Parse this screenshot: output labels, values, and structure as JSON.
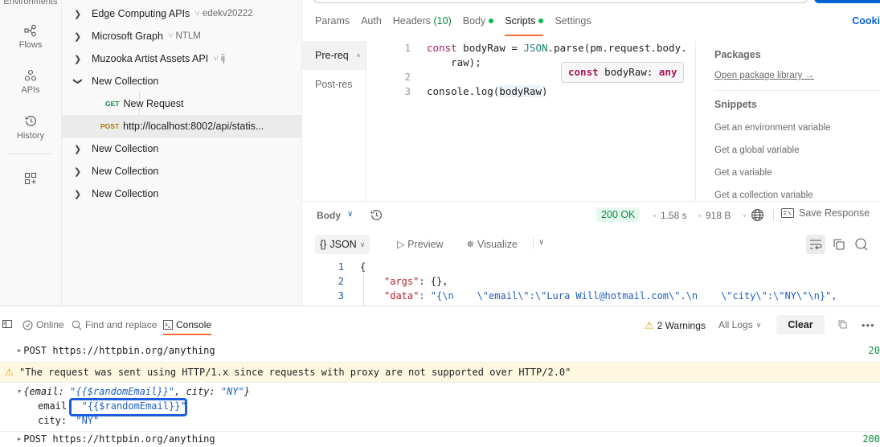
{
  "rail": {
    "items": [
      {
        "label": "Environments",
        "icon": "environments-icon"
      },
      {
        "label": "Flows",
        "icon": "flows-icon"
      },
      {
        "label": "APIs",
        "icon": "apis-icon"
      },
      {
        "label": "History",
        "icon": "history-icon"
      },
      {
        "label": "",
        "icon": "add-workspace-icon"
      }
    ]
  },
  "tree": {
    "items": [
      {
        "name": "Edge Computing APIs",
        "fork": "edekv20222",
        "expanded": false
      },
      {
        "name": "Microsoft Graph",
        "fork": "NTLM",
        "expanded": false
      },
      {
        "name": "Muzooka Artist Assets API",
        "fork": "ij",
        "expanded": false
      },
      {
        "name": "New Collection",
        "expanded": true
      },
      {
        "method": "GET",
        "name": "New Request"
      },
      {
        "method": "POST",
        "name": "http://localhost:8002/api/statis...",
        "selected": true
      },
      {
        "name": "New Collection",
        "expanded": false
      },
      {
        "name": "New Collection",
        "expanded": false
      },
      {
        "name": "New Collection",
        "expanded": false
      }
    ]
  },
  "request": {
    "tabs": [
      {
        "label": "Params"
      },
      {
        "label": "Auth"
      },
      {
        "label": "Headers",
        "count": "(10)"
      },
      {
        "label": "Body",
        "dot": true
      },
      {
        "label": "Scripts",
        "dot": true,
        "active": true
      },
      {
        "label": "Settings"
      }
    ],
    "cookies_label": "Cooki",
    "script_nav": [
      {
        "label": "Pre-req",
        "active": true
      },
      {
        "label": "Post-res"
      }
    ],
    "code_lines": [
      {
        "num": "1",
        "text_kw": "const",
        "text_a": " bodyRaw = ",
        "text_ty": "JSON",
        "text_b": ".parse(pm.request.body."
      },
      {
        "num": "",
        "cont": "    raw);"
      },
      {
        "num": "2",
        "cont": ""
      },
      {
        "num": "3",
        "pre": "console.log(",
        "hl": "bodyRaw",
        "post": ")"
      }
    ],
    "tooltip": {
      "kw": "const",
      "name": " bodyRaw: ",
      "type": "any"
    },
    "side": {
      "packages_title": "Packages",
      "open_library": "Open package library →",
      "snippets_title": "Snippets",
      "snippets": [
        "Get an environment variable",
        "Get a global variable",
        "Get a variable",
        "Get a collection variable"
      ]
    }
  },
  "response": {
    "body_label": "Body",
    "status": "200 OK",
    "time": "1.58 s",
    "size": "918 B",
    "save_label": "Save Response",
    "format": "JSON",
    "preview_label": "Preview",
    "visualize_label": "Visualize",
    "lines": [
      {
        "num": "1",
        "text": "{"
      },
      {
        "num": "2",
        "key": "\"args\"",
        "rest": ": {},"
      },
      {
        "num": "3",
        "key": "\"data\"",
        "rest": ": \"{\\n    \\\"email\\\":\\\"Lura Will@hotmail.com\\\".\\n    \\\"city\\\":\\\"NY\\\"\\n}\","
      }
    ]
  },
  "console": {
    "online_label": "Online",
    "find_label": "Find and replace",
    "console_label": "Console",
    "warnings_label": "2 Warnings",
    "filter_label": "All Logs",
    "clear_label": "Clear",
    "logs": [
      {
        "type": "request",
        "text": "POST https://httpbin.org/anything",
        "status": "20"
      },
      {
        "type": "warning",
        "text": "\"The request was sent using HTTP/1.x since requests with proxy are not supported over HTTP/2.0\""
      },
      {
        "type": "object",
        "summary_open": "{email: ",
        "summary_email": "\"{{$randomEmail}}\"",
        "summary_mid": ", city: ",
        "summary_city": "\"NY\"",
        "summary_close": "}",
        "email_key": "email:",
        "email_val": "\"{{$randomEmail}}\"",
        "city_key": "city:",
        "city_val": "\"NY\""
      },
      {
        "type": "request",
        "text": "POST https://httpbin.org/anything",
        "status": "200"
      }
    ]
  }
}
